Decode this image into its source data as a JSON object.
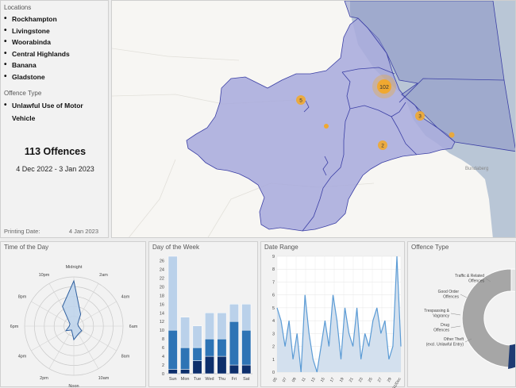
{
  "sidebar": {
    "locations_label": "Locations",
    "locations": [
      "Rockhampton",
      "Livingstone",
      "Woorabinda",
      "Central Highlands",
      "Banana",
      "Gladstone"
    ],
    "offence_label": "Offence Type",
    "offences": [
      "Unlawful Use of Motor Vehicle"
    ],
    "total": "113 Offences",
    "date_range": "4 Dec 2022 - 3 Jan 2023",
    "printing_label": "Printing Date:",
    "printing_value": "4 Jan 2023"
  },
  "map": {
    "clusters": [
      {
        "label": "102",
        "color": "#f0a830"
      },
      {
        "label": "5",
        "color": "#f0a830"
      },
      {
        "label": "3",
        "color": "#f0a830"
      },
      {
        "label": "2",
        "color": "#f0a830"
      }
    ],
    "place_label": "Bundaberg",
    "region_fill": "#a7a9dc",
    "sea_fill": "#b9c6d6"
  },
  "panels": {
    "time_of_day": "Time of the Day",
    "day_of_week": "Day of the Week",
    "date_range": "Date Range",
    "offence_type": "Offence Type"
  },
  "chart_data": [
    {
      "type": "radar",
      "title": "Time of the Day",
      "categories": [
        "Midnight",
        "2am",
        "4am",
        "6am",
        "8am",
        "10am",
        "Noon",
        "2pm",
        "4pm",
        "6pm",
        "8pm",
        "10pm"
      ],
      "values": [
        10,
        3,
        1,
        1,
        2,
        2,
        3,
        1,
        2,
        1,
        1,
        5
      ],
      "grid": true
    },
    {
      "type": "bar",
      "title": "Day of the Week",
      "categories": [
        "Sun",
        "Mon",
        "Tue",
        "Wed",
        "Thu",
        "Fri",
        "Sat"
      ],
      "series": [
        {
          "values": [
            1,
            1,
            3,
            4,
            4,
            2,
            2
          ],
          "color": "#0d2f6b"
        },
        {
          "values": [
            9,
            5,
            3,
            4,
            4,
            10,
            8
          ],
          "color": "#2e74b5"
        },
        {
          "values": [
            17,
            7,
            5,
            6,
            6,
            4,
            6
          ],
          "color": "#bad1ea"
        }
      ],
      "ylim": [
        0,
        27
      ],
      "yticks": [
        0,
        2,
        4,
        6,
        8,
        10,
        12,
        14,
        16,
        18,
        20,
        22,
        24,
        26
      ],
      "stacked": true
    },
    {
      "type": "area",
      "title": "Date Range",
      "x_labels": [
        "05",
        "07",
        "09",
        "11",
        "13",
        "15",
        "17",
        "19",
        "21",
        "23",
        "25",
        "27",
        "29",
        "31/Dec"
      ],
      "values": [
        5,
        4,
        2,
        4,
        1,
        3,
        0,
        6,
        3,
        1,
        0,
        2,
        4,
        2,
        6,
        4,
        1,
        5,
        3,
        2,
        5,
        1,
        3,
        2,
        4,
        5,
        3,
        4,
        1,
        2,
        9,
        2
      ],
      "ylim": [
        0,
        9
      ],
      "yticks": [
        0,
        1,
        2,
        3,
        4,
        5,
        6,
        7,
        8,
        9
      ],
      "color": "#5b9bd5",
      "fill": "#d3e0ee"
    },
    {
      "type": "pie",
      "title": "Offence Type",
      "labels": [
        "Traffic & Related Offences",
        "Good Order Offences",
        "Trespassing & Vagrancy",
        "Drug Offences",
        "Other Theft (excl. Unlawful Entry)"
      ],
      "values": [
        12,
        8,
        6,
        6,
        40
      ],
      "colors": [
        "#e3e3e3",
        "#d0d0d0",
        "#bfbfbf",
        "#c9c9c9",
        "#a6a6a6"
      ]
    }
  ]
}
